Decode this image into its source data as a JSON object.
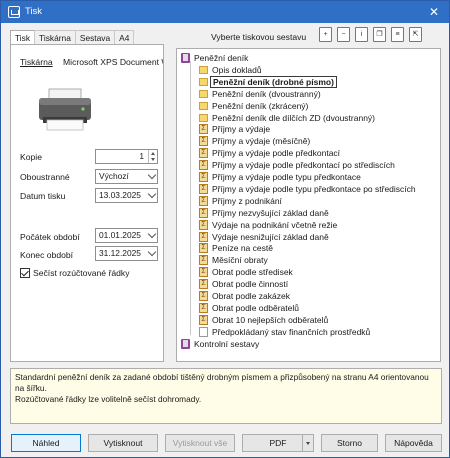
{
  "window": {
    "title": "Tisk",
    "close_glyph": "✕"
  },
  "tabs": [
    {
      "label": "Tisk"
    },
    {
      "label": "Tiskárna"
    },
    {
      "label": "Sestava"
    },
    {
      "label": "A4"
    }
  ],
  "printer": {
    "label": "Tiskárna",
    "name": "Microsoft XPS Document W"
  },
  "fields": {
    "kopie_label": "Kopie",
    "kopie_value": "1",
    "oboustranne_label": "Oboustranné",
    "oboustranne_value": "Výchozí",
    "datum_tisku_label": "Datum tisku",
    "datum_tisku_value": "13.03.2025",
    "pocatek_label": "Počátek období",
    "pocatek_value": "01.01.2025",
    "konec_label": "Konec období",
    "konec_value": "31.12.2025",
    "secist_label": "Sečíst rozúčtované řádky"
  },
  "report_selector": {
    "title": "Vyberte tiskovou sestavu",
    "toolbar_icons": [
      "add-icon",
      "remove-icon",
      "info-icon",
      "copy-icon",
      "document-icon",
      "export-icon"
    ],
    "items": [
      {
        "label": "Peněžní deník",
        "icon": "book"
      },
      {
        "label": "Opis dokladů",
        "icon": "folder"
      },
      {
        "label": "Peněžní deník (drobné písmo)",
        "icon": "folder"
      },
      {
        "label": "Peněžní deník (dvoustranný)",
        "icon": "folder"
      },
      {
        "label": "Peněžní deník (zkrácený)",
        "icon": "folder"
      },
      {
        "label": "Peněžní deník dle dílčích ZD (dvoustranný)",
        "icon": "folder"
      },
      {
        "label": "Příjmy a výdaje",
        "icon": "sigma"
      },
      {
        "label": "Příjmy a výdaje (měsíčně)",
        "icon": "sigma"
      },
      {
        "label": "Příjmy a výdaje podle předkontací",
        "icon": "sigma"
      },
      {
        "label": "Příjmy a výdaje podle předkontací po střediscích",
        "icon": "sigma"
      },
      {
        "label": "Příjmy a výdaje podle typu předkontace",
        "icon": "sigma"
      },
      {
        "label": "Příjmy a výdaje podle typu předkontace po střediscích",
        "icon": "sigma"
      },
      {
        "label": "Příjmy z podnikání",
        "icon": "sigma"
      },
      {
        "label": "Příjmy nezvyšující základ daně",
        "icon": "sigma"
      },
      {
        "label": "Výdaje na podnikání včetně režie",
        "icon": "sigma"
      },
      {
        "label": "Výdaje nesnižující základ daně",
        "icon": "sigma"
      },
      {
        "label": "Peníze na cestě",
        "icon": "sigma"
      },
      {
        "label": "Měsíční obraty",
        "icon": "sigma"
      },
      {
        "label": "Obrat podle středisek",
        "icon": "sigma"
      },
      {
        "label": "Obrat podle činností",
        "icon": "sigma"
      },
      {
        "label": "Obrat podle zakázek",
        "icon": "sigma"
      },
      {
        "label": "Obrat podle odběratelů",
        "icon": "sigma"
      },
      {
        "label": "Obrat 10 nejlepších odběratelů",
        "icon": "sigma"
      },
      {
        "label": "Předpokládaný stav finančních prostředků",
        "icon": "doc"
      },
      {
        "label": "Kontrolní sestavy",
        "icon": "book"
      }
    ],
    "selected_index": 2
  },
  "description": {
    "line1": "Standardní peněžní deník za zadané období tištěný drobným písmem a přizpůsobený na stranu A4 orientovanou na šířku.",
    "line2": "Rozúčtované řádky lze volitelně sečíst dohromady."
  },
  "buttons": {
    "nahled": "Náhled",
    "vytisknout": "Vytisknout",
    "vytisknout_vse": "Vytisknout vše",
    "pdf": "PDF",
    "storno": "Storno",
    "napoveda": "Nápověda"
  },
  "colors": {
    "titlebar": "#2f6fc6",
    "selection_border": "#3a3a3a",
    "description_bg": "#fffde8"
  }
}
